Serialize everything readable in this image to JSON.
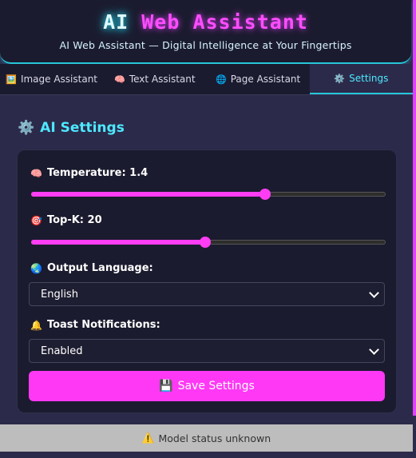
{
  "header": {
    "title_ai": "AI",
    "title_rest": "Web Assistant",
    "subtitle": "AI Web Assistant — Digital Intelligence at Your Fingertips"
  },
  "tabs": [
    {
      "icon": "🖼️",
      "label": "Image Assistant"
    },
    {
      "icon": "🧠",
      "label": "Text Assistant"
    },
    {
      "icon": "🌐",
      "label": "Page Assistant"
    },
    {
      "icon": "⚙️",
      "label": "Settings"
    }
  ],
  "settings": {
    "icon": "⚙️",
    "title": "AI Settings",
    "temperature": {
      "icon": "🧠",
      "label": "Temperature: 1.4",
      "fraction": 0.66
    },
    "topk": {
      "icon": "🎯",
      "label": "Top-K: 20",
      "fraction": 0.49
    },
    "language": {
      "icon": "🌏",
      "label": "Output Language:",
      "value": "English"
    },
    "toast": {
      "icon": "🔔",
      "label": "Toast Notifications:",
      "value": "Enabled"
    },
    "save": {
      "icon": "💾",
      "label": "Save Settings"
    }
  },
  "status": {
    "icon": "⚠️",
    "text": "Model status unknown"
  },
  "colors": {
    "accent_cyan": "#4de8ff",
    "accent_magenta": "#ff38f5"
  }
}
